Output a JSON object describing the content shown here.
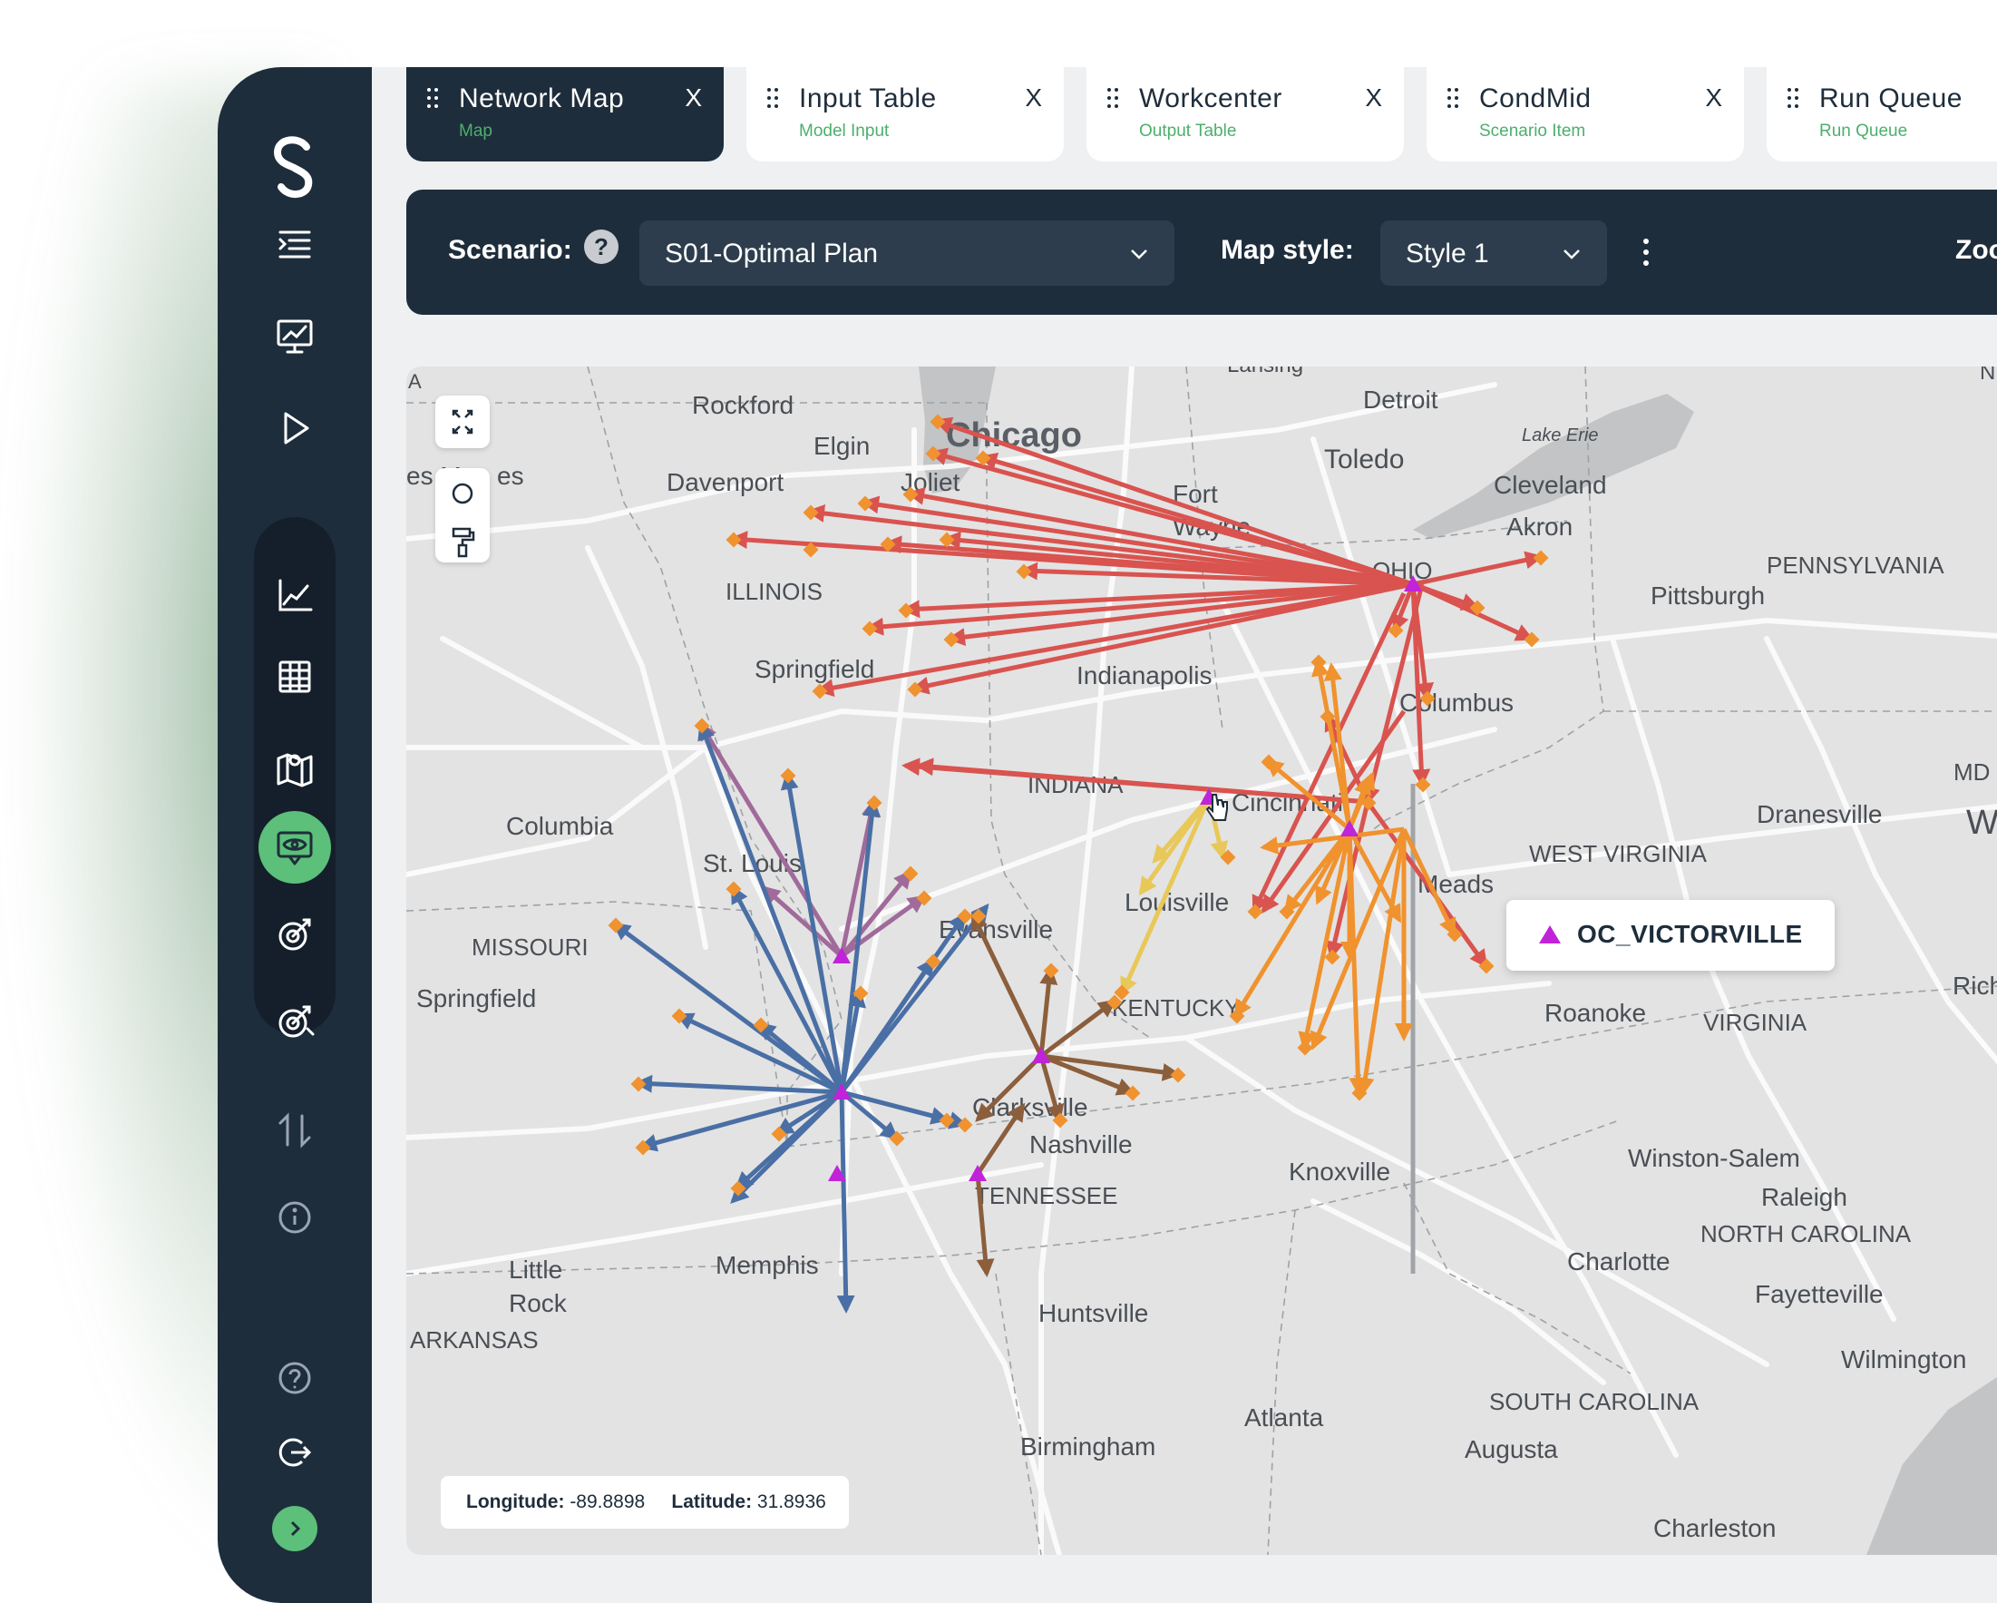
{
  "tabs": [
    {
      "title": "Network Map",
      "subtitle": "Map",
      "close": "X",
      "active": true
    },
    {
      "title": "Input Table",
      "subtitle": "Model Input",
      "close": "X",
      "active": false
    },
    {
      "title": "Workcenter",
      "subtitle": "Output Table",
      "close": "X",
      "active": false
    },
    {
      "title": "CondMid",
      "subtitle": "Scenario Item",
      "close": "X",
      "active": false
    },
    {
      "title": "Run Queue",
      "subtitle": "Run Queue",
      "close": "X",
      "active": false
    }
  ],
  "toolbar": {
    "scenario_label": "Scenario:",
    "help": "?",
    "scenario_value": "S01-Optimal Plan",
    "map_style_label": "Map style:",
    "map_style_value": "Style 1",
    "zoom_label": "Zoo"
  },
  "sidebar": {
    "items": [
      "menu-icon",
      "dashboard-icon",
      "run-icon",
      "analytics-icon",
      "table-icon",
      "map-icon",
      "visualize-icon",
      "scenario-target-icon",
      "scenario-compare-icon",
      "transfer-icon",
      "info-icon"
    ],
    "active": "visualize-icon",
    "bottom": [
      "help-icon",
      "logout-icon",
      "expand-icon"
    ]
  },
  "map": {
    "tooltip": "OC_VICTORVILLE",
    "coords": {
      "longitude_label": "Longitude:",
      "longitude": "-89.8898",
      "latitude_label": "Latitude:",
      "latitude": "31.8936"
    },
    "labels": [
      "A",
      "Rockford",
      "Chicago",
      "Detroit",
      "Lansing",
      "Lake Erie",
      "NEW",
      "Elgin",
      "Joliet",
      "Davenport",
      "es M",
      "es",
      "Toledo",
      "Fort",
      "Wayne",
      "Cleveland",
      "Akron",
      "PENNSYLVANIA",
      "ILLINOIS",
      "OHIO",
      "Pittsburgh",
      "Springfield",
      "Indianapolis",
      "Columbus",
      "INDIANA",
      "Cincinnati",
      "MD",
      "Dranesville",
      "Was",
      "Columbia",
      "St. Louis",
      "WEST VIRGINIA",
      "Meads",
      "Louisville",
      "Evansville",
      "MISSOURI",
      "Springfield",
      "KENTUCKY",
      "Roanoke",
      "VIRGINIA",
      "Richmon",
      "Clarksville",
      "Nashville",
      "TENNESSEE",
      "Knoxville",
      "Winston-Salem",
      "Raleigh",
      "NORTH CAROLINA",
      "Little",
      "Rock",
      "Memphis",
      "ARKANSAS",
      "Huntsville",
      "Charlotte",
      "Fayetteville",
      "Wilmington",
      "SOUTH CAROLINA",
      "Atlanta",
      "Augusta",
      "Birmingham",
      "Charleston"
    ],
    "colors": {
      "red": "#d9534f",
      "blue": "#4a6fa5",
      "orange": "#f0922e",
      "brown": "#8b5e3c",
      "purple": "#a06a9a",
      "yellow": "#e8c858",
      "node": "#f0922e",
      "dc": "#c023d8"
    }
  }
}
